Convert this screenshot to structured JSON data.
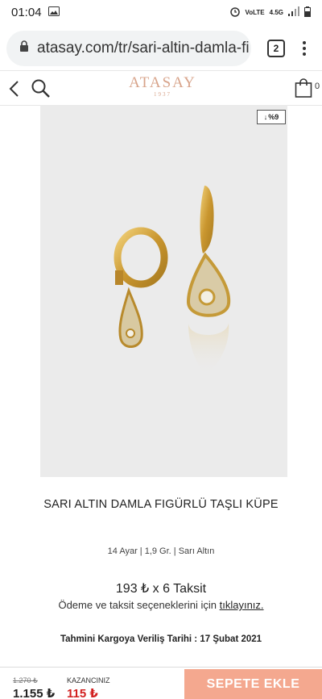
{
  "status_bar": {
    "time": "01:04",
    "network_volte": "VoLTE",
    "network_type": "4.5G"
  },
  "browser": {
    "url": "atasay.com/tr/sari-altin-damla-fi",
    "tab_count": "2"
  },
  "header": {
    "logo_word": "ATASAY",
    "logo_year": "1937",
    "cart_count": "0"
  },
  "product": {
    "discount_badge": "%9",
    "title": "SARI ALTIN DAMLA FIGÜRLÜ TAŞLI KÜPE",
    "specs": "14 Ayar | 1,9 Gr. | Sarı Altın",
    "installment": "193 ₺ x 6 Taksit",
    "installment_note": "Ödeme ve taksit seçeneklerini için",
    "installment_link": "tıklayınız.",
    "delivery": "Tahmini Kargoya Veriliş Tarihi : 17 Şubat 2021"
  },
  "bottom_bar": {
    "old_price": "1.270 ₺",
    "new_price": "1.155 ₺",
    "savings_label": "KAZANCINIZ",
    "savings_value": "115 ₺",
    "add_to_cart": "SEPETE EKLE"
  },
  "colors": {
    "brand": "#d8a48b",
    "button": "#f4a88f",
    "savings": "#d21f1f",
    "image_bg": "#ebebeb"
  }
}
